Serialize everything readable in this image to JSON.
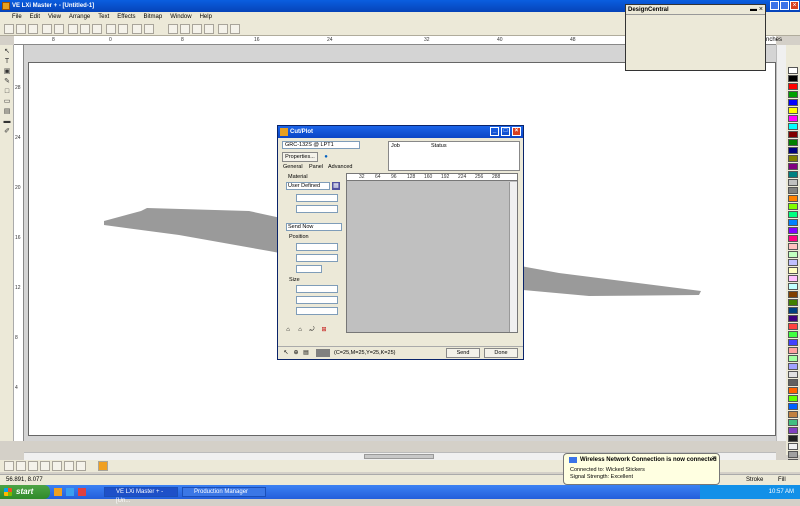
{
  "window": {
    "title": "VE LXi Master + - [Untitled-1]"
  },
  "menu": [
    "File",
    "Edit",
    "View",
    "Arrange",
    "Text",
    "Effects",
    "Bitmap",
    "Window",
    "Help"
  ],
  "rulers": {
    "top_labels": [
      "8",
      "0",
      "8",
      "16",
      "24",
      "32",
      "40",
      "48"
    ],
    "left_labels": [
      "28",
      "24",
      "20",
      "16",
      "12",
      "8",
      "4"
    ],
    "units": "inches"
  },
  "design_central": {
    "title": "DesignCentral"
  },
  "cutplot": {
    "title": "Cut/Plot",
    "device": "GRC-132S @ LPT1",
    "properties_label": "Properties...",
    "job_header": "Job",
    "status_header": "Status",
    "tabs": [
      "General",
      "Panel",
      "Advanced"
    ],
    "material_label": "Material",
    "material_value": "User Defined",
    "send_mode": "Send Now",
    "position_label": "Position",
    "size_label": "Size",
    "ruler_marks": [
      "32",
      "64",
      "96",
      "128",
      "160",
      "192",
      "224",
      "256",
      "288"
    ],
    "coords": "(C=25,M=25,Y=25,K=25)",
    "send_label": "Send",
    "done_label": "Done"
  },
  "status": {
    "coords": "56.891, 8.077",
    "stroke": "Stroke",
    "fill": "Fill"
  },
  "notification": {
    "title": "Wireless Network Connection is now connected",
    "line1": "Connected to: Wicked Stickers",
    "line2": "Signal Strength: Excellent"
  },
  "taskbar": {
    "start": "start",
    "tasks": [
      "VE LXi Master + - [Un...",
      "Production Manager"
    ],
    "time": "10:57 AM"
  },
  "colors": {
    "palette": [
      "#ffffff",
      "#000000",
      "#ff0000",
      "#00a000",
      "#0000ff",
      "#ffff00",
      "#ff00ff",
      "#00ffff",
      "#800000",
      "#008000",
      "#000080",
      "#808000",
      "#800080",
      "#008080",
      "#c0c0c0",
      "#808080",
      "#ff8000",
      "#80ff00",
      "#00ff80",
      "#0080ff",
      "#8000ff",
      "#ff0080",
      "#ffc0c0",
      "#c0ffc0",
      "#c0c0ff",
      "#ffffc0",
      "#ffc0ff",
      "#c0ffff",
      "#804000",
      "#408000",
      "#004080",
      "#400080",
      "#ff4040",
      "#40ff40",
      "#4040ff",
      "#ffa0a0",
      "#a0ffa0",
      "#a0a0ff",
      "#e0e0e0",
      "#606060",
      "#ff6000",
      "#60ff00",
      "#0060ff",
      "#c08040",
      "#40c080",
      "#8040c0",
      "#202020",
      "#f0f0f0",
      "#a0a0a0",
      "#505050"
    ]
  }
}
